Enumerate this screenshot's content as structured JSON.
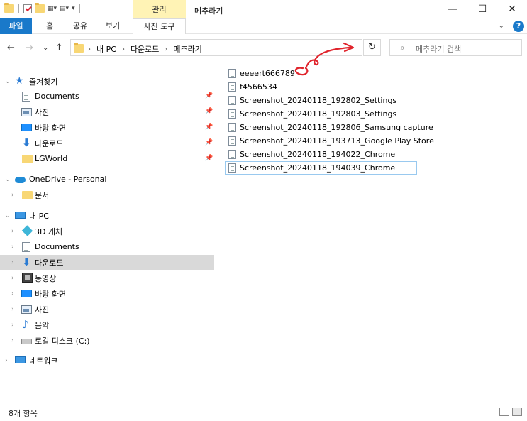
{
  "window": {
    "title": "메추라기",
    "contextual_tab": "관리",
    "minimize": "—",
    "maximize": "☐",
    "close": "✕"
  },
  "ribbon": {
    "tabs": [
      "파일",
      "홈",
      "공유",
      "보기",
      "사진 도구"
    ],
    "collapse": "⌄",
    "help": "?"
  },
  "nav": {
    "back": "←",
    "forward": "→",
    "recent": "⌄",
    "up": "↑",
    "breadcrumb": [
      "내 PC",
      "다운로드",
      "메추라기"
    ],
    "separator": "›",
    "refresh": "↻",
    "search_placeholder": "메추라기 검색"
  },
  "sidebar": {
    "items": [
      {
        "label": "즐겨찾기",
        "icon": "star-icon"
      },
      {
        "label": "Documents",
        "icon": "documents-icon",
        "pinned": true
      },
      {
        "label": "사진",
        "icon": "pictures-icon",
        "pinned": true
      },
      {
        "label": "바탕 화면",
        "icon": "desktop-icon",
        "pinned": true
      },
      {
        "label": "다운로드",
        "icon": "download-icon",
        "pinned": true
      },
      {
        "label": "LGWorld",
        "icon": "folder-icon",
        "pinned": true
      },
      {
        "label": "OneDrive - Personal",
        "icon": "cloud-icon"
      },
      {
        "label": "문서",
        "icon": "folder-icon"
      },
      {
        "label": "내 PC",
        "icon": "pc-icon"
      },
      {
        "label": "3D 개체",
        "icon": "3d-objects-icon"
      },
      {
        "label": "Documents",
        "icon": "documents-icon"
      },
      {
        "label": "다운로드",
        "icon": "download-icon",
        "selected": true
      },
      {
        "label": "동영상",
        "icon": "videos-icon"
      },
      {
        "label": "바탕 화면",
        "icon": "desktop-icon"
      },
      {
        "label": "사진",
        "icon": "pictures-icon"
      },
      {
        "label": "음악",
        "icon": "music-icon"
      },
      {
        "label": "로컬 디스크 (C:)",
        "icon": "disk-icon"
      },
      {
        "label": "네트워크",
        "icon": "network-icon"
      }
    ]
  },
  "files": [
    "eeeert666789",
    "f4566534",
    "Screenshot_20240118_192802_Settings",
    "Screenshot_20240118_192803_Settings",
    "Screenshot_20240118_192806_Samsung capture",
    "Screenshot_20240118_193713_Google Play Store",
    "Screenshot_20240118_194022_Chrome",
    "Screenshot_20240118_194039_Chrome"
  ],
  "status": {
    "item_count": "8개 항목"
  },
  "colors": {
    "accent": "#1979ca",
    "contextual_tab": "#fff3b5",
    "selected_row": "#d9d9d9",
    "annotation": "#e0242c"
  }
}
